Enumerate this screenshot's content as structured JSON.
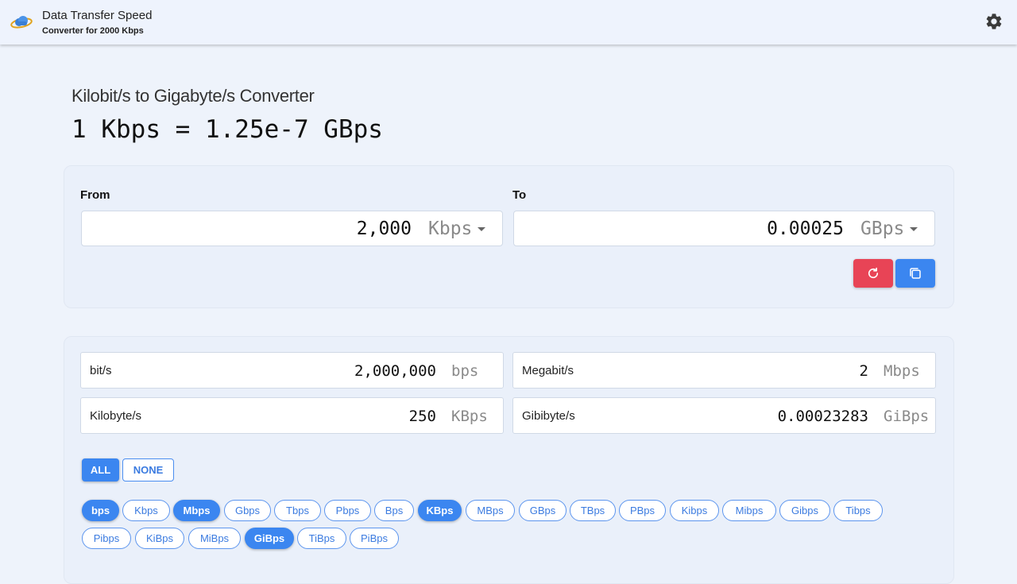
{
  "header": {
    "app_title": "Data Transfer Speed",
    "app_subtitle": "Converter for 2000 Kbps",
    "logo_icon": "cloud-logo-icon",
    "settings_icon": "gear-icon"
  },
  "main": {
    "heading": "Kilobit/s to Gigabyte/s Converter",
    "equation": "1 Kbps = 1.25e-7 GBps"
  },
  "converter": {
    "from_label": "From",
    "from_value": "2,000",
    "from_unit": "Kbps",
    "to_label": "To",
    "to_value": "0.00025",
    "to_unit": "GBps",
    "reset_icon": "refresh-icon",
    "copy_icon": "copy-icon",
    "colors": {
      "reset": "#e84456",
      "copy": "#3b86f0"
    }
  },
  "results": [
    {
      "label": "bit/s",
      "value": "2,000,000",
      "unit": "bps"
    },
    {
      "label": "Megabit/s",
      "value": "2",
      "unit": "Mbps"
    },
    {
      "label": "Kilobyte/s",
      "value": "250",
      "unit": "KBps"
    },
    {
      "label": "Gibibyte/s",
      "value": "0.00023283",
      "unit": "GiBps"
    }
  ],
  "filters": {
    "all_label": "ALL",
    "none_label": "NONE"
  },
  "units": [
    {
      "label": "bps",
      "selected": true
    },
    {
      "label": "Kbps",
      "selected": false
    },
    {
      "label": "Mbps",
      "selected": true
    },
    {
      "label": "Gbps",
      "selected": false
    },
    {
      "label": "Tbps",
      "selected": false
    },
    {
      "label": "Pbps",
      "selected": false
    },
    {
      "label": "Bps",
      "selected": false
    },
    {
      "label": "KBps",
      "selected": true
    },
    {
      "label": "MBps",
      "selected": false
    },
    {
      "label": "GBps",
      "selected": false
    },
    {
      "label": "TBps",
      "selected": false
    },
    {
      "label": "PBps",
      "selected": false
    },
    {
      "label": "Kibps",
      "selected": false
    },
    {
      "label": "Mibps",
      "selected": false
    },
    {
      "label": "Gibps",
      "selected": false
    },
    {
      "label": "Tibps",
      "selected": false
    },
    {
      "label": "Pibps",
      "selected": false
    },
    {
      "label": "KiBps",
      "selected": false
    },
    {
      "label": "MiBps",
      "selected": false
    },
    {
      "label": "GiBps",
      "selected": true
    },
    {
      "label": "TiBps",
      "selected": false
    },
    {
      "label": "PiBps",
      "selected": false
    }
  ],
  "theme": {
    "accent": "#3b86f0",
    "danger": "#e84456",
    "background": "#eef3fb"
  }
}
